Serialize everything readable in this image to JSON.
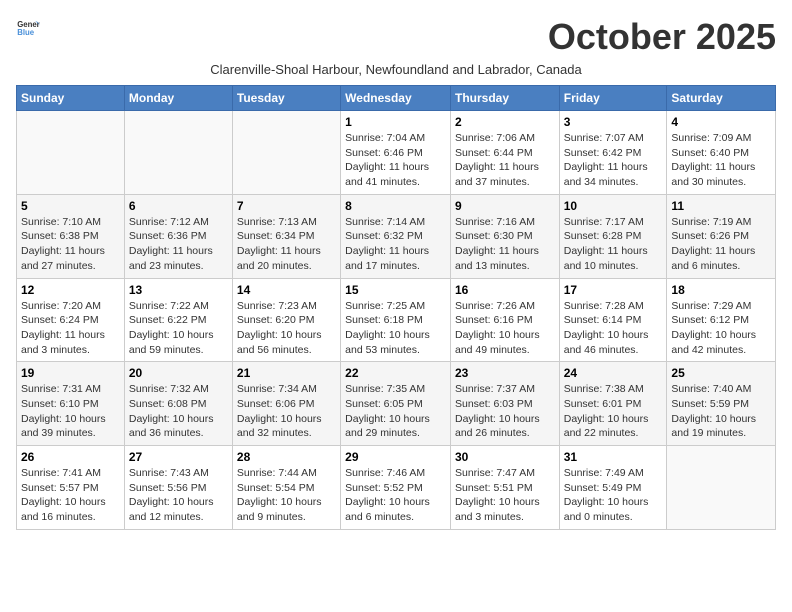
{
  "header": {
    "logo_general": "General",
    "logo_blue": "Blue",
    "month_title": "October 2025",
    "subtitle": "Clarenville-Shoal Harbour, Newfoundland and Labrador, Canada"
  },
  "days_of_week": [
    "Sunday",
    "Monday",
    "Tuesday",
    "Wednesday",
    "Thursday",
    "Friday",
    "Saturday"
  ],
  "weeks": [
    [
      {
        "day": "",
        "info": ""
      },
      {
        "day": "",
        "info": ""
      },
      {
        "day": "",
        "info": ""
      },
      {
        "day": "1",
        "info": "Sunrise: 7:04 AM\nSunset: 6:46 PM\nDaylight: 11 hours and 41 minutes."
      },
      {
        "day": "2",
        "info": "Sunrise: 7:06 AM\nSunset: 6:44 PM\nDaylight: 11 hours and 37 minutes."
      },
      {
        "day": "3",
        "info": "Sunrise: 7:07 AM\nSunset: 6:42 PM\nDaylight: 11 hours and 34 minutes."
      },
      {
        "day": "4",
        "info": "Sunrise: 7:09 AM\nSunset: 6:40 PM\nDaylight: 11 hours and 30 minutes."
      }
    ],
    [
      {
        "day": "5",
        "info": "Sunrise: 7:10 AM\nSunset: 6:38 PM\nDaylight: 11 hours and 27 minutes."
      },
      {
        "day": "6",
        "info": "Sunrise: 7:12 AM\nSunset: 6:36 PM\nDaylight: 11 hours and 23 minutes."
      },
      {
        "day": "7",
        "info": "Sunrise: 7:13 AM\nSunset: 6:34 PM\nDaylight: 11 hours and 20 minutes."
      },
      {
        "day": "8",
        "info": "Sunrise: 7:14 AM\nSunset: 6:32 PM\nDaylight: 11 hours and 17 minutes."
      },
      {
        "day": "9",
        "info": "Sunrise: 7:16 AM\nSunset: 6:30 PM\nDaylight: 11 hours and 13 minutes."
      },
      {
        "day": "10",
        "info": "Sunrise: 7:17 AM\nSunset: 6:28 PM\nDaylight: 11 hours and 10 minutes."
      },
      {
        "day": "11",
        "info": "Sunrise: 7:19 AM\nSunset: 6:26 PM\nDaylight: 11 hours and 6 minutes."
      }
    ],
    [
      {
        "day": "12",
        "info": "Sunrise: 7:20 AM\nSunset: 6:24 PM\nDaylight: 11 hours and 3 minutes."
      },
      {
        "day": "13",
        "info": "Sunrise: 7:22 AM\nSunset: 6:22 PM\nDaylight: 10 hours and 59 minutes."
      },
      {
        "day": "14",
        "info": "Sunrise: 7:23 AM\nSunset: 6:20 PM\nDaylight: 10 hours and 56 minutes."
      },
      {
        "day": "15",
        "info": "Sunrise: 7:25 AM\nSunset: 6:18 PM\nDaylight: 10 hours and 53 minutes."
      },
      {
        "day": "16",
        "info": "Sunrise: 7:26 AM\nSunset: 6:16 PM\nDaylight: 10 hours and 49 minutes."
      },
      {
        "day": "17",
        "info": "Sunrise: 7:28 AM\nSunset: 6:14 PM\nDaylight: 10 hours and 46 minutes."
      },
      {
        "day": "18",
        "info": "Sunrise: 7:29 AM\nSunset: 6:12 PM\nDaylight: 10 hours and 42 minutes."
      }
    ],
    [
      {
        "day": "19",
        "info": "Sunrise: 7:31 AM\nSunset: 6:10 PM\nDaylight: 10 hours and 39 minutes."
      },
      {
        "day": "20",
        "info": "Sunrise: 7:32 AM\nSunset: 6:08 PM\nDaylight: 10 hours and 36 minutes."
      },
      {
        "day": "21",
        "info": "Sunrise: 7:34 AM\nSunset: 6:06 PM\nDaylight: 10 hours and 32 minutes."
      },
      {
        "day": "22",
        "info": "Sunrise: 7:35 AM\nSunset: 6:05 PM\nDaylight: 10 hours and 29 minutes."
      },
      {
        "day": "23",
        "info": "Sunrise: 7:37 AM\nSunset: 6:03 PM\nDaylight: 10 hours and 26 minutes."
      },
      {
        "day": "24",
        "info": "Sunrise: 7:38 AM\nSunset: 6:01 PM\nDaylight: 10 hours and 22 minutes."
      },
      {
        "day": "25",
        "info": "Sunrise: 7:40 AM\nSunset: 5:59 PM\nDaylight: 10 hours and 19 minutes."
      }
    ],
    [
      {
        "day": "26",
        "info": "Sunrise: 7:41 AM\nSunset: 5:57 PM\nDaylight: 10 hours and 16 minutes."
      },
      {
        "day": "27",
        "info": "Sunrise: 7:43 AM\nSunset: 5:56 PM\nDaylight: 10 hours and 12 minutes."
      },
      {
        "day": "28",
        "info": "Sunrise: 7:44 AM\nSunset: 5:54 PM\nDaylight: 10 hours and 9 minutes."
      },
      {
        "day": "29",
        "info": "Sunrise: 7:46 AM\nSunset: 5:52 PM\nDaylight: 10 hours and 6 minutes."
      },
      {
        "day": "30",
        "info": "Sunrise: 7:47 AM\nSunset: 5:51 PM\nDaylight: 10 hours and 3 minutes."
      },
      {
        "day": "31",
        "info": "Sunrise: 7:49 AM\nSunset: 5:49 PM\nDaylight: 10 hours and 0 minutes."
      },
      {
        "day": "",
        "info": ""
      }
    ]
  ]
}
